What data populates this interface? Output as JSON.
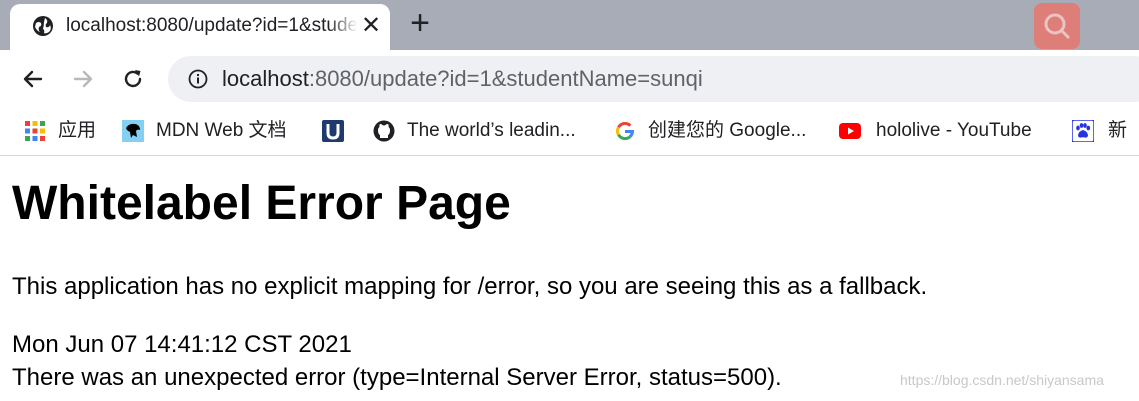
{
  "tab": {
    "title": "localhost:8080/update?id=1&studentName=sunqi",
    "close_label": "✕",
    "new_tab_label": "+"
  },
  "toolbar": {
    "url_host": "localhost",
    "url_rest": ":8080/update?id=1&studentName=sunqi"
  },
  "bookmarks": [
    {
      "label": "应用",
      "icon": "apps-grid-icon"
    },
    {
      "label": "MDN Web 文档",
      "icon": "mdn-icon"
    },
    {
      "label": "",
      "icon": "u-bookmark-icon"
    },
    {
      "label": "The world’s leadin...",
      "icon": "github-icon"
    },
    {
      "label": "创建您的 Google...",
      "icon": "google-icon"
    },
    {
      "label": "hololive - YouTube",
      "icon": "youtube-icon"
    },
    {
      "label": "新",
      "icon": "baidu-paw-icon"
    }
  ],
  "page": {
    "heading": "Whitelabel Error Page",
    "explanation": "This application has no explicit mapping for /error, so you are seeing this as a fallback.",
    "timestamp": "Mon Jun 07 14:41:12 CST 2021",
    "error_detail": "There was an unexpected error (type=Internal Server Error, status=500).",
    "watermark": "https://blog.csdn.net/shiyansama"
  },
  "colors": {
    "tabstrip_bg": "#a8acb6",
    "omnibox_bg": "#eef0f3",
    "youtube_red": "#ff0000",
    "google_blue": "#4285f4"
  }
}
